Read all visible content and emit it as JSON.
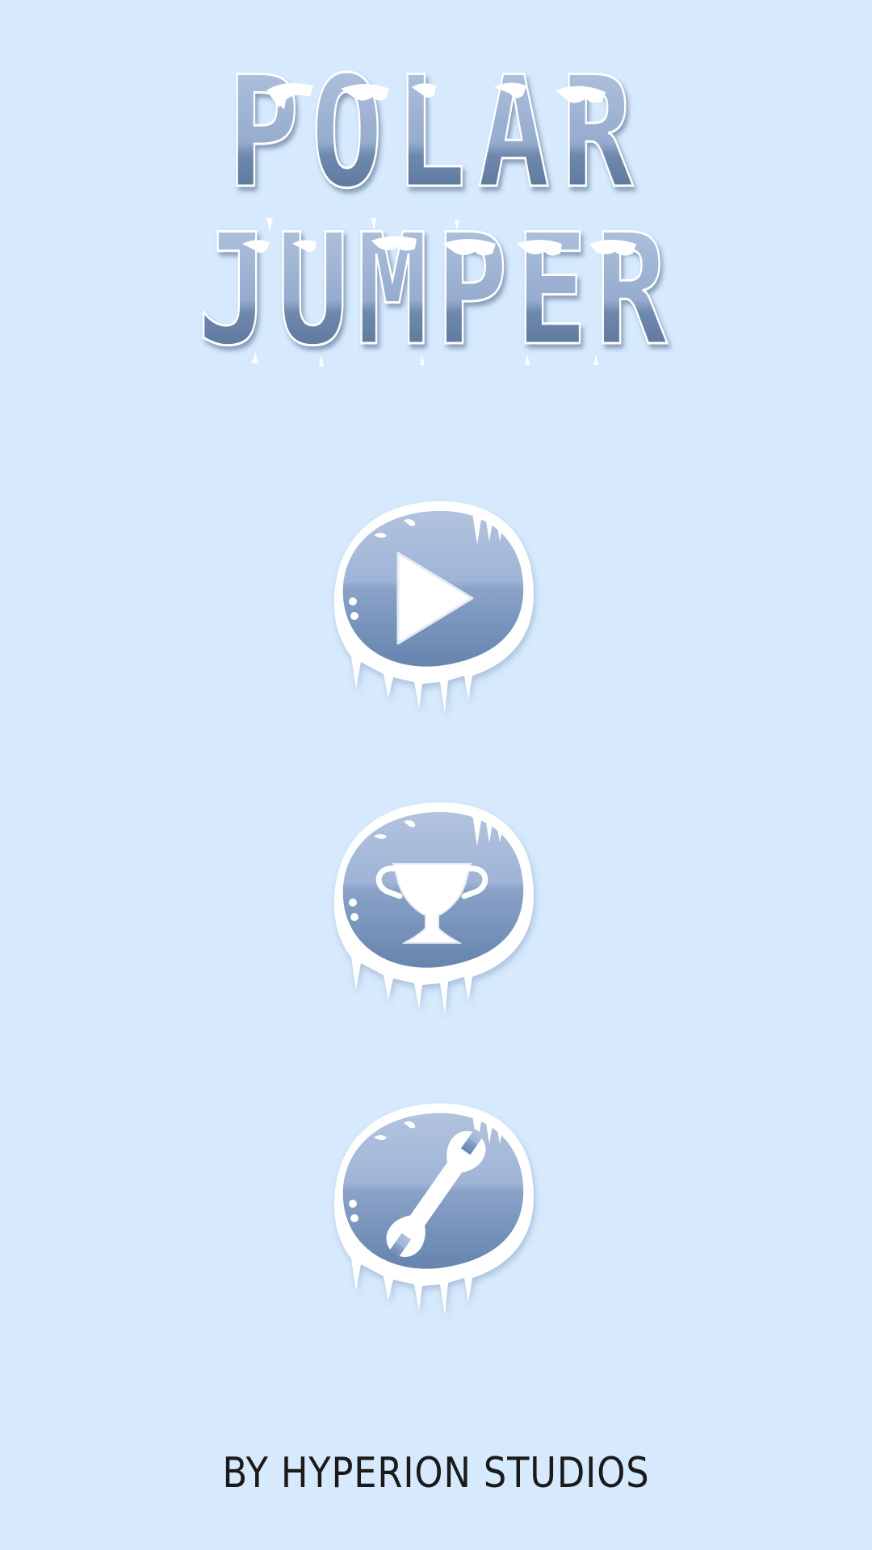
{
  "game": {
    "title_line1": "POLAR",
    "title_line2": "JUMPER"
  },
  "menu": {
    "buttons": [
      {
        "action": "play",
        "icon": "play-icon"
      },
      {
        "action": "leaderboard",
        "icon": "trophy-icon"
      },
      {
        "action": "settings",
        "icon": "wrench-icon"
      }
    ]
  },
  "footer": {
    "credit": "BY HYPERION STUDIOS"
  },
  "colors": {
    "background": "#d6e9fd",
    "ice_dark": "#5e7ea3",
    "ice_light": "#b9c9e2",
    "snow": "#ffffff",
    "credit_text": "#1a1a1a"
  }
}
